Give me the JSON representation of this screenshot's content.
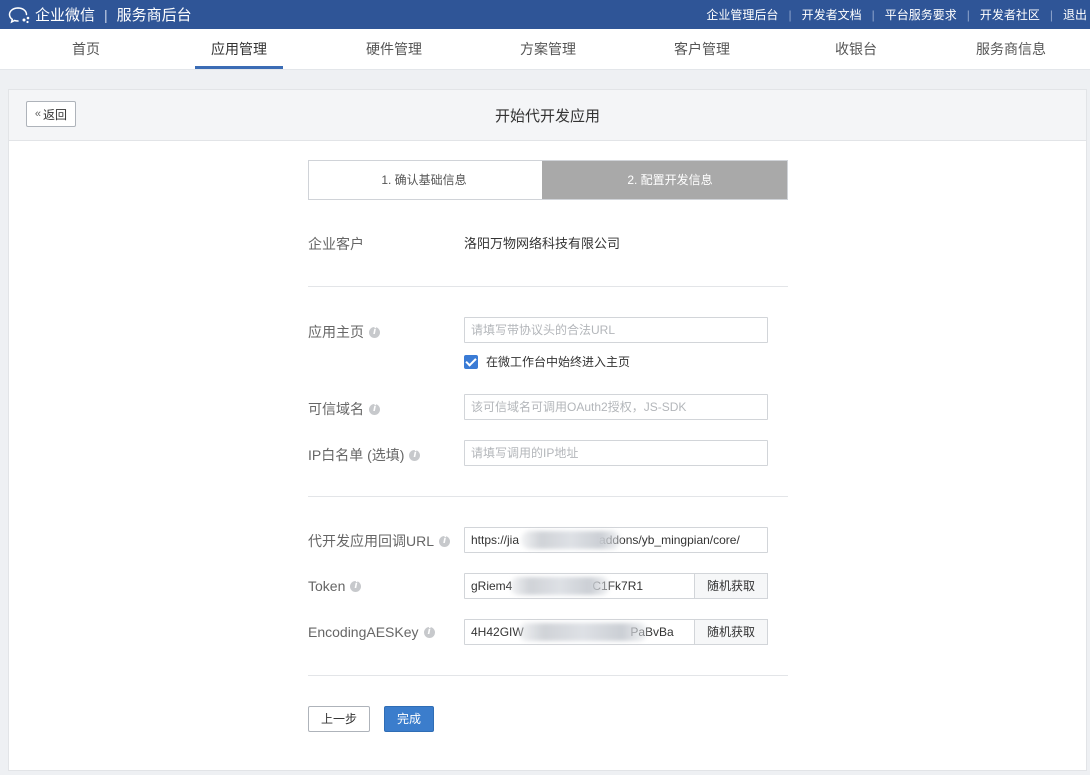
{
  "header": {
    "brand_name": "企业微信",
    "brand_separator": "|",
    "brand_sub": "服务商后台",
    "links": [
      "企业管理后台",
      "开发者文档",
      "平台服务要求",
      "开发者社区",
      "退出"
    ],
    "link_separator": "|",
    "bg_color": "#2f5597"
  },
  "nav": {
    "items": [
      "首页",
      "应用管理",
      "硬件管理",
      "方案管理",
      "客户管理",
      "收银台",
      "服务商信息"
    ],
    "active": "应用管理",
    "accent_color": "#3b6cb5"
  },
  "panel": {
    "back_label": "返回",
    "title": "开始代开发应用"
  },
  "steps": {
    "step1": "1. 确认基础信息",
    "step2": "2. 配置开发信息",
    "active_step": 2
  },
  "form": {
    "customer_label": "企业客户",
    "customer_value": "洛阳万物网络科技有限公司",
    "homepage_label": "应用主页",
    "homepage_placeholder": "请填写带协议头的合法URL",
    "homepage_checkbox_label": "在微工作台中始终进入主页",
    "homepage_checkbox_checked": true,
    "domain_label": "可信域名",
    "domain_placeholder": "该可信域名可调用OAuth2授权，JS-SDK",
    "ip_label": "IP白名单 (选填)",
    "ip_placeholder": "请填写调用的IP地址",
    "callback_label": "代开发应用回调URL",
    "callback_value": "https://jia                        addons/yb_mingpian/core/",
    "token_label": "Token",
    "token_value": "gRiem4                        C1Fk7R1",
    "token_button": "随机获取",
    "aeskey_label": "EncodingAESKey",
    "aeskey_value": "4H42GIW                                PaBvBa",
    "aeskey_button": "随机获取"
  },
  "actions": {
    "prev_label": "上一步",
    "done_label": "完成",
    "done_color": "#3b7dcc"
  }
}
